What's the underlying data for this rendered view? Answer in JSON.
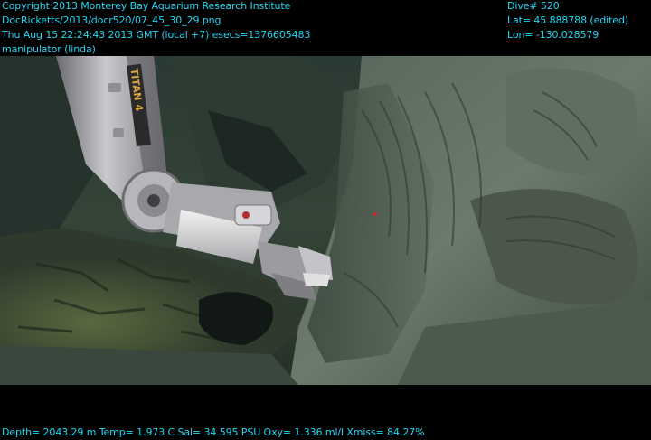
{
  "header_left": {
    "copyright": "Copyright 2013 Monterey Bay Aquarium Research Institute",
    "file_path": "DocRicketts/2013/docr520/07_45_30_29.png",
    "datetime": "Thu Aug 15 22:24:43 2013 GMT (local +7)  esecs=1376605483",
    "camera": "manipulator (linda)"
  },
  "header_right": {
    "dive": "Dive# 520",
    "lat": "Lat= 45.888788 (edited)",
    "lon": "Lon= -130.028579"
  },
  "footer": {
    "telemetry": "Depth= 2043.29 m  Temp= 1.973 C  Sal= 34.595 PSU  Oxy= 1.336 ml/l  Xmiss= 84.27%"
  },
  "arm_label": "TITAN 4",
  "colors": {
    "overlay_text": "#22d6f2",
    "background": "#000000"
  }
}
